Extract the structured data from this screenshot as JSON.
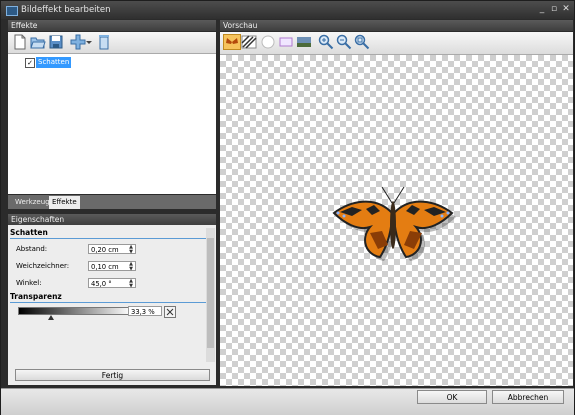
{
  "window": {
    "title": "Bildeffekt bearbeiten",
    "minimize": "_",
    "maximize": "▫",
    "close": "✕"
  },
  "left_panel": {
    "header": "Effekte"
  },
  "tree": {
    "item_label": "Schatten",
    "checkmark": "✓"
  },
  "tabs": [
    {
      "label": "Werkzeuge"
    },
    {
      "label": "Effekte"
    }
  ],
  "properties": {
    "header": "Eigenschaften",
    "section_schatten": "Schatten",
    "abstand": {
      "label": "Abstand:",
      "value": "0,20 cm"
    },
    "weichzeichner": {
      "label": "Weichzeichner:",
      "value": "0,10 cm"
    },
    "winkel": {
      "label": "Winkel:",
      "value": "45,0 °"
    },
    "section_transparenz": "Transparenz",
    "transparenz_value": "33,3 %"
  },
  "fertig_button": "Fertig",
  "preview": {
    "header": "Vorschau"
  },
  "footer": {
    "ok": "OK",
    "cancel": "Abbrechen"
  }
}
